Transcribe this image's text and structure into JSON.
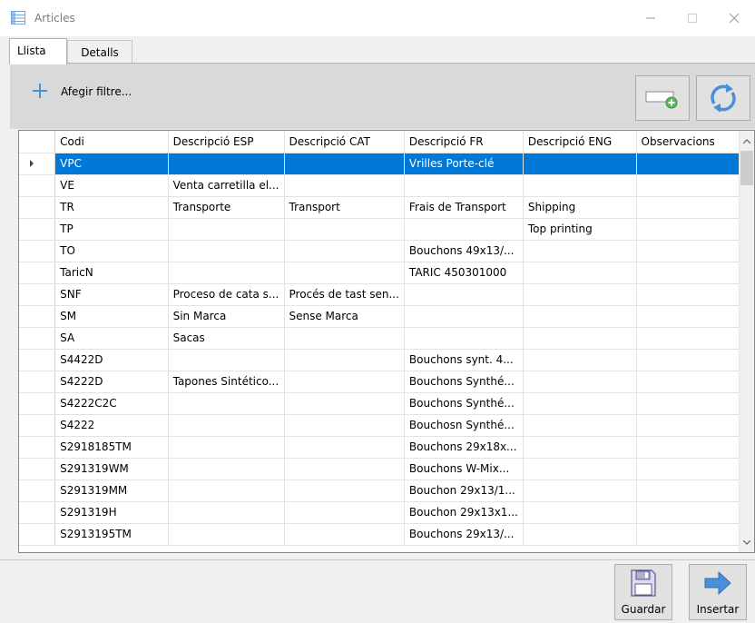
{
  "window": {
    "title": "Articles",
    "app_icon": "table-window-icon",
    "controls": {
      "minimize": "—",
      "maximize": "☐",
      "close": "✕"
    }
  },
  "tabs": [
    {
      "label": "Llista",
      "active": true
    },
    {
      "label": "Detalls",
      "active": false
    }
  ],
  "filter_bar": {
    "add_filter_label": "Afegir filtre...",
    "add_icon": "plus-icon",
    "tool_add_icon": "add-field-icon",
    "tool_refresh_icon": "refresh-icon"
  },
  "grid": {
    "columns": [
      "Codi",
      "Descripció ESP",
      "Descripció CAT",
      "Descripció FR",
      "Descripció ENG",
      "Observacions"
    ],
    "selected_row": 0,
    "rows": [
      [
        "VPC",
        "",
        "",
        "Vrilles Porte-clé",
        "",
        ""
      ],
      [
        "VE",
        "Venta carretilla el...",
        "",
        "",
        "",
        ""
      ],
      [
        "TR",
        "Transporte",
        "Transport",
        "Frais de Transport",
        "Shipping",
        ""
      ],
      [
        "TP",
        "",
        "",
        "",
        "Top printing",
        ""
      ],
      [
        "TO",
        "",
        "",
        "Bouchons 49x13/...",
        "",
        ""
      ],
      [
        "TaricN",
        "",
        "",
        "TARIC 450301000",
        "",
        ""
      ],
      [
        "SNF",
        "Proceso de cata s...",
        "Procés de tast sen...",
        "",
        "",
        ""
      ],
      [
        "SM",
        "Sin Marca",
        "Sense Marca",
        "",
        "",
        ""
      ],
      [
        "SA",
        "Sacas",
        "",
        "",
        "",
        ""
      ],
      [
        "S4422D",
        "",
        "",
        "Bouchons synt. 4...",
        "",
        ""
      ],
      [
        "S4222D",
        "Tapones Sintético...",
        "",
        "Bouchons Synthé...",
        "",
        ""
      ],
      [
        "S4222C2C",
        "",
        "",
        "Bouchons Synthé...",
        "",
        ""
      ],
      [
        "S4222",
        "",
        "",
        "Bouchosn Synthé...",
        "",
        ""
      ],
      [
        "S2918185TM",
        "",
        "",
        "Bouchons 29x18x...",
        "",
        ""
      ],
      [
        "S291319WM",
        "",
        "",
        "Bouchons W-Mix...",
        "",
        ""
      ],
      [
        "S291319MM",
        "",
        "",
        "Bouchon 29x13/1...",
        "",
        ""
      ],
      [
        "S291319H",
        "",
        "",
        "Bouchon 29x13x1...",
        "",
        ""
      ],
      [
        "S2913195TM",
        "",
        "",
        "Bouchons 29x13/...",
        "",
        ""
      ]
    ]
  },
  "buttons": {
    "save_label": "Guardar",
    "insert_label": "Insertar",
    "save_icon": "floppy-disk-icon",
    "insert_icon": "arrow-right-icon"
  },
  "colors": {
    "selection": "#0078d7",
    "accent": "#4a90d9"
  }
}
